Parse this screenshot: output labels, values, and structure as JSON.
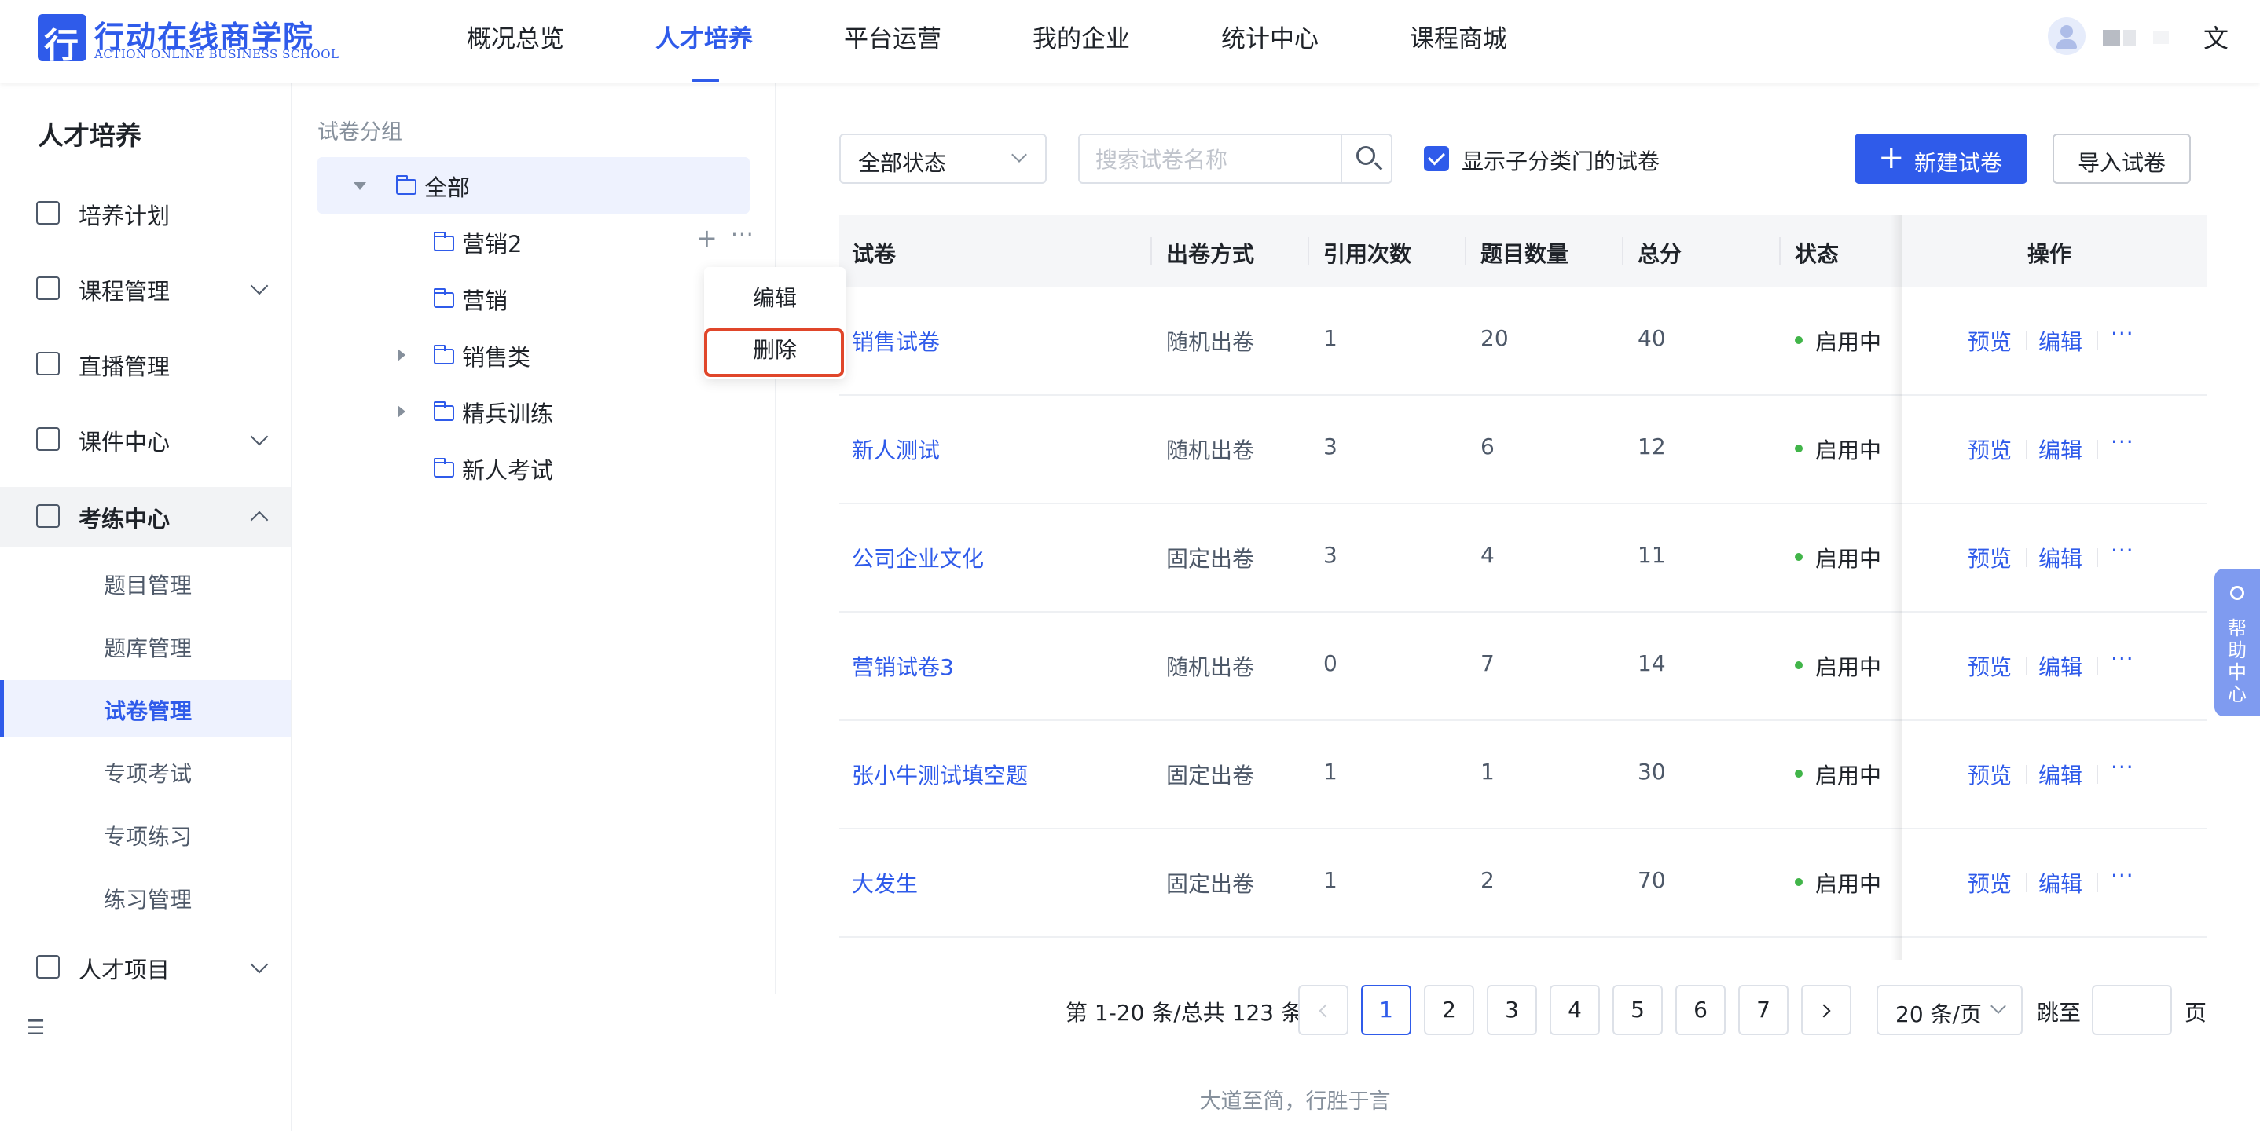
{
  "header": {
    "logo_cn": "行动在线商学院",
    "logo_en": "ACTION ONLINE BUSINESS SCHOOL",
    "nav": [
      "概况总览",
      "人才培养",
      "平台运营",
      "我的企业",
      "统计中心",
      "课程商城"
    ],
    "active_nav": "人才培养"
  },
  "sidebar": {
    "title": "人才培养",
    "items": [
      {
        "label": "培养计划",
        "icon": "calendar-icon"
      },
      {
        "label": "课程管理",
        "icon": "book-icon"
      },
      {
        "label": "直播管理",
        "icon": "video-icon"
      },
      {
        "label": "课件中心",
        "icon": "inbox-icon"
      },
      {
        "label": "考练中心",
        "icon": "exam-icon"
      },
      {
        "label": "人才项目",
        "icon": "project-icon"
      }
    ],
    "sub_items": [
      "题目管理",
      "题库管理",
      "试卷管理",
      "专项考试",
      "专项练习",
      "练习管理"
    ],
    "active_sub": "试卷管理"
  },
  "group_panel": {
    "title": "试卷分组",
    "tree": [
      "全部",
      "营销2",
      "营销",
      "销售类",
      "精兵训练",
      "新人考试"
    ],
    "popup": {
      "edit": "编辑",
      "delete": "删除"
    }
  },
  "toolbar": {
    "status_select": "全部状态",
    "search_placeholder": "搜索试卷名称",
    "checkbox_label": "显示子分类门的试卷",
    "new_button": "新建试卷",
    "import_button": "导入试卷"
  },
  "table": {
    "columns": [
      "试卷",
      "出卷方式",
      "引用次数",
      "题目数量",
      "总分",
      "状态",
      "操作"
    ],
    "rows": [
      {
        "name": "销售试卷",
        "mode": "随机出卷",
        "refs": "1",
        "count": "20",
        "score": "40",
        "status": "启用中"
      },
      {
        "name": "新人测试",
        "mode": "随机出卷",
        "refs": "3",
        "count": "6",
        "score": "12",
        "status": "启用中"
      },
      {
        "name": "公司企业文化",
        "mode": "固定出卷",
        "refs": "3",
        "count": "4",
        "score": "11",
        "status": "启用中"
      },
      {
        "name": "营销试卷3",
        "mode": "随机出卷",
        "refs": "0",
        "count": "7",
        "score": "14",
        "status": "启用中"
      },
      {
        "name": "张小牛测试填空题",
        "mode": "固定出卷",
        "refs": "1",
        "count": "1",
        "score": "30",
        "status": "启用中"
      },
      {
        "name": "大发生",
        "mode": "固定出卷",
        "refs": "1",
        "count": "2",
        "score": "70",
        "status": "启用中"
      }
    ],
    "actions": {
      "preview": "预览",
      "edit": "编辑",
      "more": "···"
    }
  },
  "pagination": {
    "total": "第 1-20 条/总共 123 条",
    "pages": [
      "1",
      "2",
      "3",
      "4",
      "5",
      "6",
      "7"
    ],
    "current": "1",
    "page_size": "20 条/页",
    "jump_label": "跳至",
    "page_suffix": "页"
  },
  "footer": "大道至简，行胜于言",
  "help": "帮助中心",
  "colors": {
    "primary": "#2f5bea",
    "status_green": "#41b549",
    "delete_highlight": "#e0462a"
  }
}
